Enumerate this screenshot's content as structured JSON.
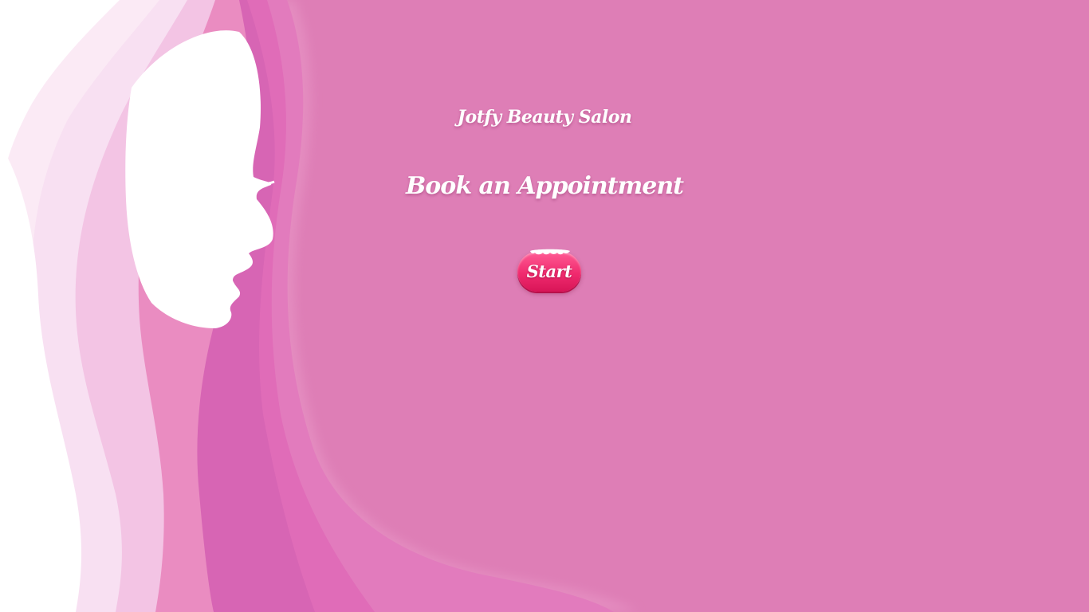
{
  "salon": {
    "name": "Jotfy Beauty Salon"
  },
  "main": {
    "heading": "Book an Appointment",
    "start_label": "Start"
  },
  "colors": {
    "background": "#de7eb6",
    "button": "#f02a6e",
    "text": "#ffffff"
  }
}
